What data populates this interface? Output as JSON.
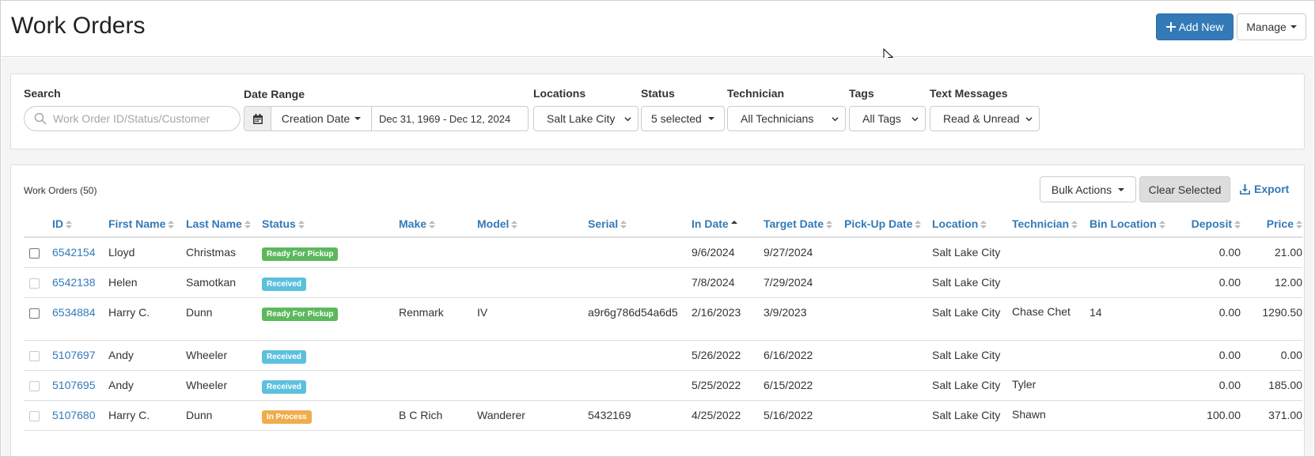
{
  "header": {
    "title": "Work Orders",
    "add_new_label": "Add New",
    "manage_label": "Manage"
  },
  "filters": {
    "search_label": "Search",
    "search_placeholder": "Work Order ID/Status/Customer",
    "date_range_label": "Date Range",
    "date_type": "Creation Date",
    "date_range_value": "Dec 31, 1969 - Dec 12, 2024",
    "locations_label": "Locations",
    "location_value": "Salt Lake City",
    "status_label": "Status",
    "status_value": "5 selected",
    "technician_label": "Technician",
    "technician_value": "All Technicians",
    "tags_label": "Tags",
    "tags_value": "All Tags",
    "text_messages_label": "Text Messages",
    "text_messages_value": "Read & Unread"
  },
  "table": {
    "title": "Work Orders (50)",
    "bulk_actions_label": "Bulk Actions",
    "clear_selected_label": "Clear Selected",
    "export_label": "Export",
    "columns": [
      "ID",
      "First Name",
      "Last Name",
      "Status",
      "Make",
      "Model",
      "Serial",
      "In Date",
      "Target Date",
      "Pick-Up Date",
      "Location",
      "Technician",
      "Bin Location",
      "Deposit",
      "Price"
    ],
    "rows": [
      {
        "id": "6542154",
        "first": "Lloyd",
        "last": "Christmas",
        "status": "Ready For Pickup",
        "status_color": "#5cb85c",
        "make": "",
        "model": "",
        "serial": "",
        "in_date": "9/6/2024",
        "target": "9/27/2024",
        "pickup": "",
        "location": "Salt Lake City",
        "tech": "",
        "bin": "",
        "deposit": "0.00",
        "price": "21.00",
        "checkbox_enabled": true
      },
      {
        "id": "6542138",
        "first": "Helen",
        "last": "Samotkan",
        "status": "Received",
        "status_color": "#5bc0de",
        "make": "",
        "model": "",
        "serial": "",
        "in_date": "7/8/2024",
        "target": "7/29/2024",
        "pickup": "",
        "location": "Salt Lake City",
        "tech": "",
        "bin": "",
        "deposit": "0.00",
        "price": "12.00",
        "checkbox_enabled": false
      },
      {
        "id": "6534884",
        "first": "Harry C.",
        "last": "Dunn",
        "status": "Ready For Pickup",
        "status_color": "#5cb85c",
        "make": "Renmark",
        "model": "IV",
        "serial": "a9r6g786d54a6d5",
        "in_date": "2/16/2023",
        "target": "3/9/2023",
        "pickup": "",
        "location": "Salt Lake City",
        "tech": "Chase Chet",
        "bin": "14",
        "deposit": "0.00",
        "price": "1290.50",
        "checkbox_enabled": true
      },
      {
        "id": "5107697",
        "first": "Andy",
        "last": "Wheeler",
        "status": "Received",
        "status_color": "#5bc0de",
        "make": "",
        "model": "",
        "serial": "",
        "in_date": "5/26/2022",
        "target": "6/16/2022",
        "pickup": "",
        "location": "Salt Lake City",
        "tech": "",
        "bin": "",
        "deposit": "0.00",
        "price": "0.00",
        "checkbox_enabled": false
      },
      {
        "id": "5107695",
        "first": "Andy",
        "last": "Wheeler",
        "status": "Received",
        "status_color": "#5bc0de",
        "make": "",
        "model": "",
        "serial": "",
        "in_date": "5/25/2022",
        "target": "6/15/2022",
        "pickup": "",
        "location": "Salt Lake City",
        "tech": "Tyler",
        "bin": "",
        "deposit": "0.00",
        "price": "185.00",
        "checkbox_enabled": false
      },
      {
        "id": "5107680",
        "first": "Harry C.",
        "last": "Dunn",
        "status": "In Process",
        "status_color": "#f0ad4e",
        "make": "B C Rich",
        "model": "Wanderer",
        "serial": "5432169",
        "in_date": "4/25/2022",
        "target": "5/16/2022",
        "pickup": "",
        "location": "Salt Lake City",
        "tech": "Shawn",
        "bin": "",
        "deposit": "100.00",
        "price": "371.00",
        "checkbox_enabled": false
      }
    ]
  }
}
